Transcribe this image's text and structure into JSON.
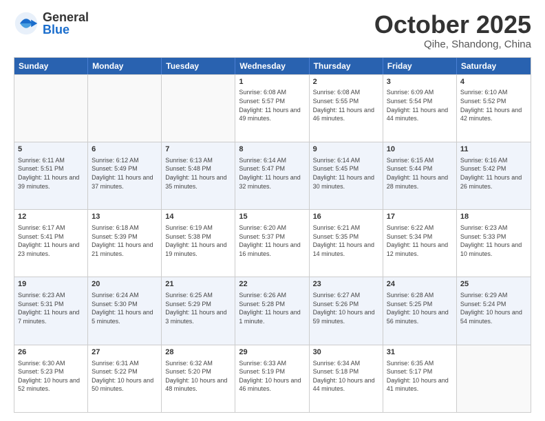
{
  "header": {
    "logo_general": "General",
    "logo_blue": "Blue",
    "month_title": "October 2025",
    "location": "Qihe, Shandong, China"
  },
  "weekdays": [
    "Sunday",
    "Monday",
    "Tuesday",
    "Wednesday",
    "Thursday",
    "Friday",
    "Saturday"
  ],
  "rows": [
    {
      "alt": false,
      "cells": [
        {
          "day": "",
          "info": ""
        },
        {
          "day": "",
          "info": ""
        },
        {
          "day": "",
          "info": ""
        },
        {
          "day": "1",
          "info": "Sunrise: 6:08 AM\nSunset: 5:57 PM\nDaylight: 11 hours and 49 minutes."
        },
        {
          "day": "2",
          "info": "Sunrise: 6:08 AM\nSunset: 5:55 PM\nDaylight: 11 hours and 46 minutes."
        },
        {
          "day": "3",
          "info": "Sunrise: 6:09 AM\nSunset: 5:54 PM\nDaylight: 11 hours and 44 minutes."
        },
        {
          "day": "4",
          "info": "Sunrise: 6:10 AM\nSunset: 5:52 PM\nDaylight: 11 hours and 42 minutes."
        }
      ]
    },
    {
      "alt": true,
      "cells": [
        {
          "day": "5",
          "info": "Sunrise: 6:11 AM\nSunset: 5:51 PM\nDaylight: 11 hours and 39 minutes."
        },
        {
          "day": "6",
          "info": "Sunrise: 6:12 AM\nSunset: 5:49 PM\nDaylight: 11 hours and 37 minutes."
        },
        {
          "day": "7",
          "info": "Sunrise: 6:13 AM\nSunset: 5:48 PM\nDaylight: 11 hours and 35 minutes."
        },
        {
          "day": "8",
          "info": "Sunrise: 6:14 AM\nSunset: 5:47 PM\nDaylight: 11 hours and 32 minutes."
        },
        {
          "day": "9",
          "info": "Sunrise: 6:14 AM\nSunset: 5:45 PM\nDaylight: 11 hours and 30 minutes."
        },
        {
          "day": "10",
          "info": "Sunrise: 6:15 AM\nSunset: 5:44 PM\nDaylight: 11 hours and 28 minutes."
        },
        {
          "day": "11",
          "info": "Sunrise: 6:16 AM\nSunset: 5:42 PM\nDaylight: 11 hours and 26 minutes."
        }
      ]
    },
    {
      "alt": false,
      "cells": [
        {
          "day": "12",
          "info": "Sunrise: 6:17 AM\nSunset: 5:41 PM\nDaylight: 11 hours and 23 minutes."
        },
        {
          "day": "13",
          "info": "Sunrise: 6:18 AM\nSunset: 5:39 PM\nDaylight: 11 hours and 21 minutes."
        },
        {
          "day": "14",
          "info": "Sunrise: 6:19 AM\nSunset: 5:38 PM\nDaylight: 11 hours and 19 minutes."
        },
        {
          "day": "15",
          "info": "Sunrise: 6:20 AM\nSunset: 5:37 PM\nDaylight: 11 hours and 16 minutes."
        },
        {
          "day": "16",
          "info": "Sunrise: 6:21 AM\nSunset: 5:35 PM\nDaylight: 11 hours and 14 minutes."
        },
        {
          "day": "17",
          "info": "Sunrise: 6:22 AM\nSunset: 5:34 PM\nDaylight: 11 hours and 12 minutes."
        },
        {
          "day": "18",
          "info": "Sunrise: 6:23 AM\nSunset: 5:33 PM\nDaylight: 11 hours and 10 minutes."
        }
      ]
    },
    {
      "alt": true,
      "cells": [
        {
          "day": "19",
          "info": "Sunrise: 6:23 AM\nSunset: 5:31 PM\nDaylight: 11 hours and 7 minutes."
        },
        {
          "day": "20",
          "info": "Sunrise: 6:24 AM\nSunset: 5:30 PM\nDaylight: 11 hours and 5 minutes."
        },
        {
          "day": "21",
          "info": "Sunrise: 6:25 AM\nSunset: 5:29 PM\nDaylight: 11 hours and 3 minutes."
        },
        {
          "day": "22",
          "info": "Sunrise: 6:26 AM\nSunset: 5:28 PM\nDaylight: 11 hours and 1 minute."
        },
        {
          "day": "23",
          "info": "Sunrise: 6:27 AM\nSunset: 5:26 PM\nDaylight: 10 hours and 59 minutes."
        },
        {
          "day": "24",
          "info": "Sunrise: 6:28 AM\nSunset: 5:25 PM\nDaylight: 10 hours and 56 minutes."
        },
        {
          "day": "25",
          "info": "Sunrise: 6:29 AM\nSunset: 5:24 PM\nDaylight: 10 hours and 54 minutes."
        }
      ]
    },
    {
      "alt": false,
      "cells": [
        {
          "day": "26",
          "info": "Sunrise: 6:30 AM\nSunset: 5:23 PM\nDaylight: 10 hours and 52 minutes."
        },
        {
          "day": "27",
          "info": "Sunrise: 6:31 AM\nSunset: 5:22 PM\nDaylight: 10 hours and 50 minutes."
        },
        {
          "day": "28",
          "info": "Sunrise: 6:32 AM\nSunset: 5:20 PM\nDaylight: 10 hours and 48 minutes."
        },
        {
          "day": "29",
          "info": "Sunrise: 6:33 AM\nSunset: 5:19 PM\nDaylight: 10 hours and 46 minutes."
        },
        {
          "day": "30",
          "info": "Sunrise: 6:34 AM\nSunset: 5:18 PM\nDaylight: 10 hours and 44 minutes."
        },
        {
          "day": "31",
          "info": "Sunrise: 6:35 AM\nSunset: 5:17 PM\nDaylight: 10 hours and 41 minutes."
        },
        {
          "day": "",
          "info": ""
        }
      ]
    }
  ]
}
